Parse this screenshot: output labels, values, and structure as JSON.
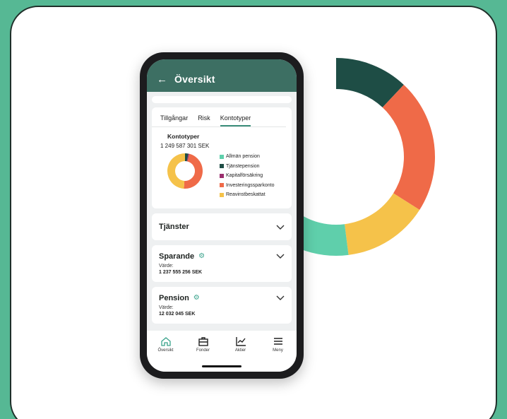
{
  "colors": {
    "background": "#56b894",
    "header": "#3d6f63",
    "accent": "#3d8f7c",
    "allman_pension": "#5fcfab",
    "tjanstepension": "#1e4d45",
    "kapitalforsakring": "#9b2f6e",
    "investeringssparkonto": "#ef6a48",
    "reavinstbeskattat": "#f5c24a"
  },
  "header": {
    "back_icon": "arrow-left-icon",
    "title": "Översikt"
  },
  "tabs": [
    {
      "label": "Tillgångar",
      "active": false
    },
    {
      "label": "Risk",
      "active": false
    },
    {
      "label": "Kontotyper",
      "active": true
    }
  ],
  "chart": {
    "title": "Kontotyper",
    "total": "1 249 587 301 SEK"
  },
  "chart_data": {
    "type": "pie",
    "categories": [
      "Allmän pension",
      "Tjänstepension",
      "Kapitalförsäkring",
      "Investeringssparkonto",
      "Reavinstbeskattat"
    ],
    "values": [
      0,
      3,
      1,
      47,
      49
    ]
  },
  "decorative_donut": {
    "values": [
      12,
      22,
      14,
      16,
      36
    ],
    "colors": [
      "#1e4d45",
      "#ef6a48",
      "#f5c24a",
      "#5fcfab",
      "#ffffff"
    ]
  },
  "sections": {
    "tjanster": {
      "title": "Tjänster"
    },
    "sparande": {
      "title": "Sparande",
      "label": "Värde:",
      "value": "1 237 555 256 SEK"
    },
    "pension": {
      "title": "Pension",
      "label": "Värde:",
      "value": "12 032 045 SEK"
    }
  },
  "nav": [
    {
      "label": "Översikt",
      "icon": "home-icon"
    },
    {
      "label": "Fonder",
      "icon": "briefcase-icon"
    },
    {
      "label": "Aktier",
      "icon": "chart-icon"
    },
    {
      "label": "Meny",
      "icon": "menu-icon"
    }
  ]
}
